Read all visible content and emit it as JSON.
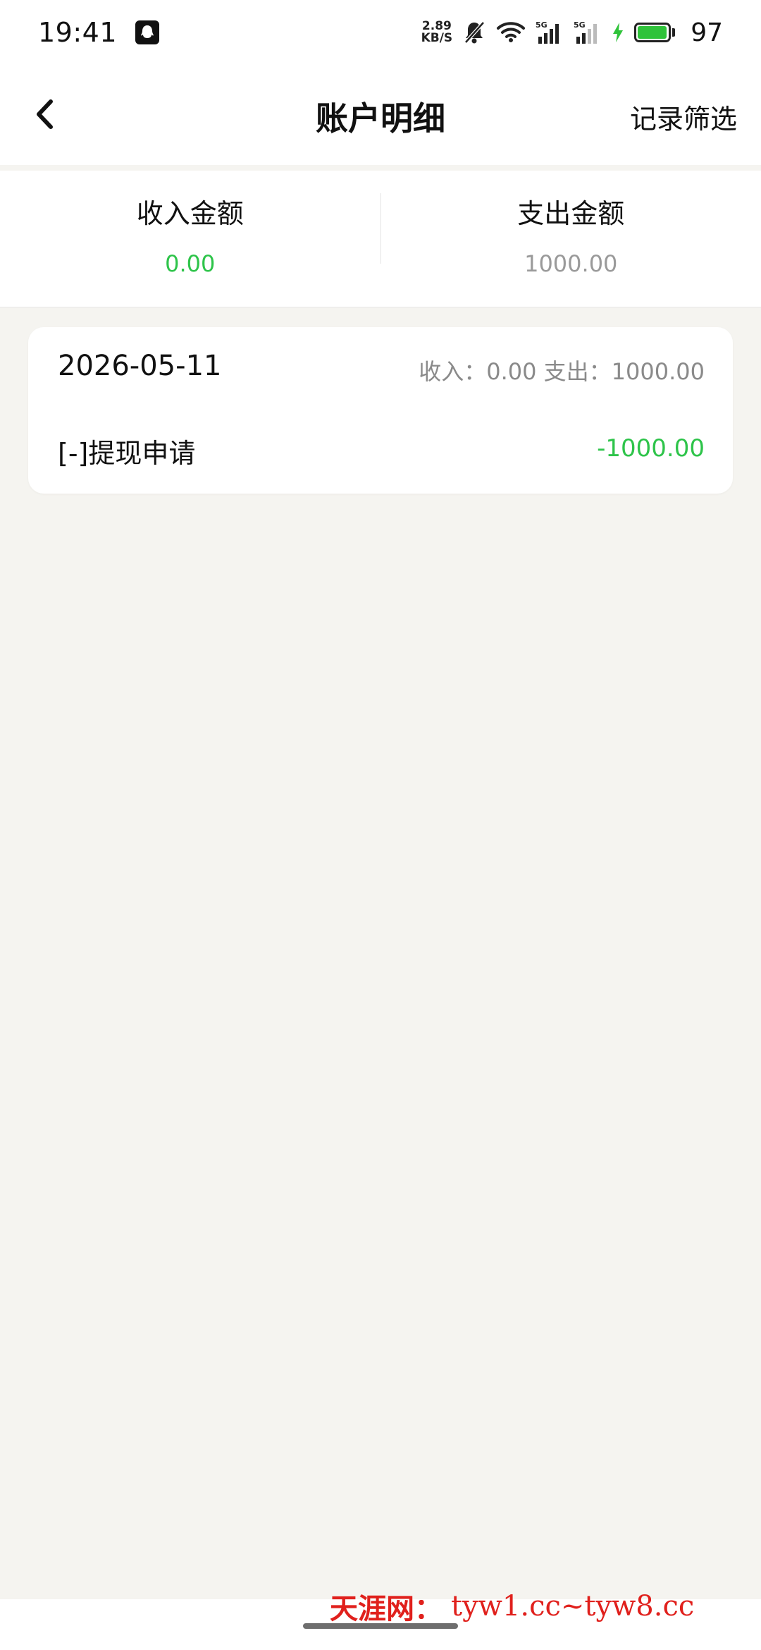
{
  "status_bar": {
    "time": "19:41",
    "net_speed_value": "2.89",
    "net_speed_unit": "KB/S",
    "sim1_label": "5G",
    "sim2_label": "5G",
    "battery_percent": "97",
    "battery_level": 0.97,
    "colors": {
      "battery": "#2fc33a"
    }
  },
  "header": {
    "title": "账户明细",
    "filter_label": "记录筛选",
    "back_icon": "chevron-left-icon"
  },
  "summary": {
    "income_label": "收入金额",
    "income_value": "0.00",
    "expense_label": "支出金额",
    "expense_value": "1000.00",
    "colors": {
      "income": "#2ec44a",
      "expense": "#9a9a9a"
    }
  },
  "records": [
    {
      "date": "2026-05-11",
      "daily_summary": "收入：0.00 支出：1000.00",
      "title": "[-]提现申请",
      "amount": "-1000.00",
      "amount_color": "#2ec44a"
    }
  ],
  "watermark": {
    "brand": "天涯网：",
    "url": "tyw1.cc~tyw8.cc",
    "color": "#e0201c"
  }
}
